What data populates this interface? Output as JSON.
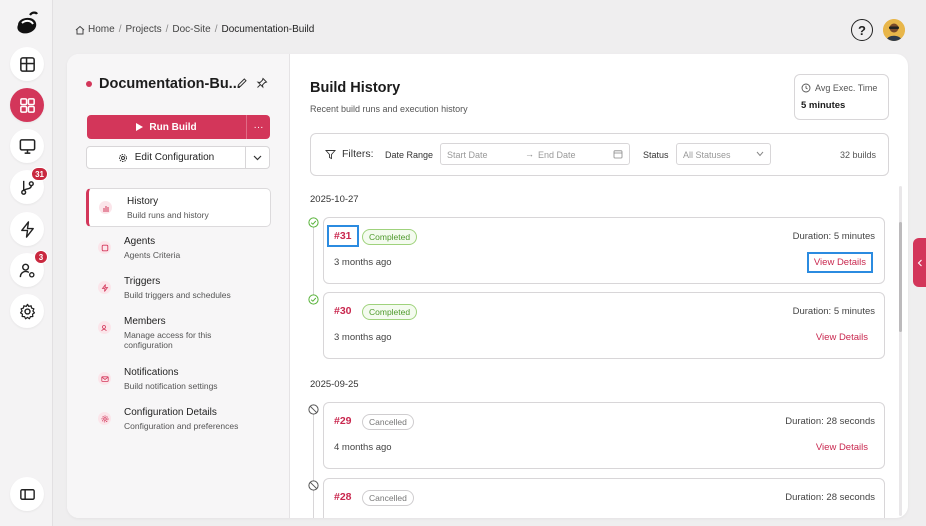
{
  "breadcrumb": {
    "items": [
      "Home",
      "Projects",
      "Doc-Site",
      "Documentation-Build"
    ],
    "separator": "/"
  },
  "rail": {
    "items": [
      {
        "icon": "layout-icon"
      },
      {
        "icon": "grid-icon",
        "active": true
      },
      {
        "icon": "monitor-icon"
      },
      {
        "icon": "git-branch-icon",
        "badge": "31"
      },
      {
        "icon": "lightning-icon"
      },
      {
        "icon": "user-settings-icon",
        "badge": "3"
      },
      {
        "icon": "gear-icon"
      }
    ],
    "collapse_icon": "sidebar-toggle-icon"
  },
  "topbar": {
    "help_glyph": "?"
  },
  "project": {
    "name": "Documentation-Bu...",
    "run_label": "Run Build",
    "more_label": "···",
    "config_label": "Edit Configuration"
  },
  "nav": [
    {
      "label": "History",
      "desc": "Build runs and history",
      "icon": "chart-icon",
      "active": true
    },
    {
      "label": "Agents",
      "desc": "Agents Criteria",
      "icon": "agent-icon"
    },
    {
      "label": "Triggers",
      "desc": "Build triggers and schedules",
      "icon": "bolt-icon"
    },
    {
      "label": "Members",
      "desc": "Manage access for this configuration",
      "icon": "members-icon"
    },
    {
      "label": "Notifications",
      "desc": "Build notification settings",
      "icon": "mail-icon"
    },
    {
      "label": "Configuration Details",
      "desc": "Configuration and preferences",
      "icon": "settings-icon"
    }
  ],
  "header": {
    "title": "Build History",
    "subtitle": "Recent build runs and execution history",
    "avg_label": "Avg Exec. Time",
    "avg_value": "5 minutes"
  },
  "filters": {
    "label": "Filters:",
    "date_range_label": "Date Range",
    "start_placeholder": "Start Date",
    "end_placeholder": "End Date",
    "status_label": "Status",
    "status_value": "All Statuses",
    "count": "32 builds"
  },
  "groups": [
    {
      "date": "2025-10-27",
      "runs": [
        {
          "id": "#31",
          "status": "Completed",
          "duration_label": "Duration:",
          "duration": "5 minutes",
          "ago": "3 months ago",
          "link": "View Details"
        },
        {
          "id": "#30",
          "status": "Completed",
          "duration_label": "Duration:",
          "duration": "5 minutes",
          "ago": "3 months ago",
          "link": "View Details"
        }
      ]
    },
    {
      "date": "2025-09-25",
      "runs": [
        {
          "id": "#29",
          "status": "Cancelled",
          "duration_label": "Duration:",
          "duration": "28 seconds",
          "ago": "4 months ago",
          "link": "View Details"
        },
        {
          "id": "#28",
          "status": "Cancelled",
          "duration_label": "Duration:",
          "duration": "28 seconds",
          "ago": "",
          "link": ""
        }
      ]
    }
  ],
  "colors": {
    "accent": "#d3365a",
    "link": "#c9284f",
    "success": "#4f9a2c",
    "highlight": "#2b8be0"
  }
}
